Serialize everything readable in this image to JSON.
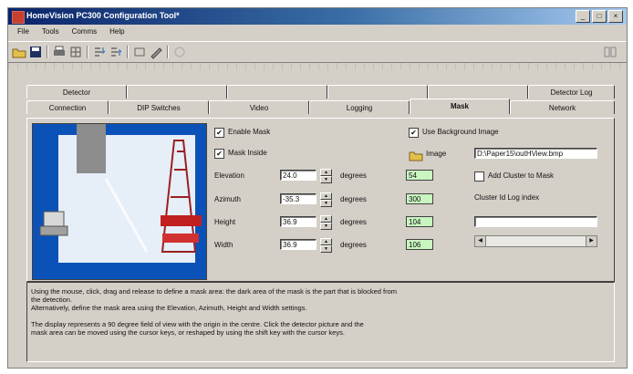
{
  "window": {
    "title": "HomeVision PC300 Configuration Tool*",
    "controls": [
      "_",
      "□",
      "×"
    ]
  },
  "menu": {
    "items": [
      "File",
      "Tools",
      "Comms",
      "Help"
    ]
  },
  "toolbar": {
    "icons": [
      "open-icon",
      "save-icon",
      "print-icon",
      "grid-icon",
      "import-icon",
      "export-icon",
      "rect-icon",
      "pen-icon",
      "circle-icon"
    ]
  },
  "tabs": {
    "row_top": [
      "Detector",
      "",
      "",
      "",
      "",
      "Detector Log"
    ],
    "row_bottom": [
      "Connection",
      "DIP Switches",
      "Video",
      "Logging",
      "Mask",
      "Network"
    ],
    "active": "Mask"
  },
  "mask": {
    "enable_mask": {
      "label": "Enable Mask",
      "checked": true
    },
    "mask_inside": {
      "label": "Mask Inside",
      "checked": true
    },
    "degrees_label": "degrees",
    "elevation": {
      "label": "Elevation",
      "value": "24.0",
      "green": "54"
    },
    "azimuth": {
      "label": "Azimuth",
      "value": "-35.3",
      "green": "300"
    },
    "height": {
      "label": "Height",
      "value": "36.9",
      "green": "104"
    },
    "width": {
      "label": "Width",
      "value": "36.9",
      "green": "106"
    },
    "use_background": {
      "label": "Use Background Image",
      "checked": true
    },
    "image_button": "Image",
    "image_path": "D:\\Paper15\\outHView.bmp",
    "add_cluster": {
      "label": "Add Cluster to Mask",
      "checked": false
    },
    "cluster_log_label": "Cluster Id Log index"
  },
  "info": {
    "lines": [
      "Using the mouse, click, drag and release to define a mask area: the dark area of the mask is the part that is blocked from",
      "the detection.",
      "Alternatively, define the mask area using the Elevation, Azimuth, Height and Width settings.",
      "",
      "The display represents a 90 degree field of view with the origin in the centre. Click the detector picture and the",
      "mask area can be moved using the cursor keys, or reshaped by using the shift key with the cursor keys."
    ]
  }
}
